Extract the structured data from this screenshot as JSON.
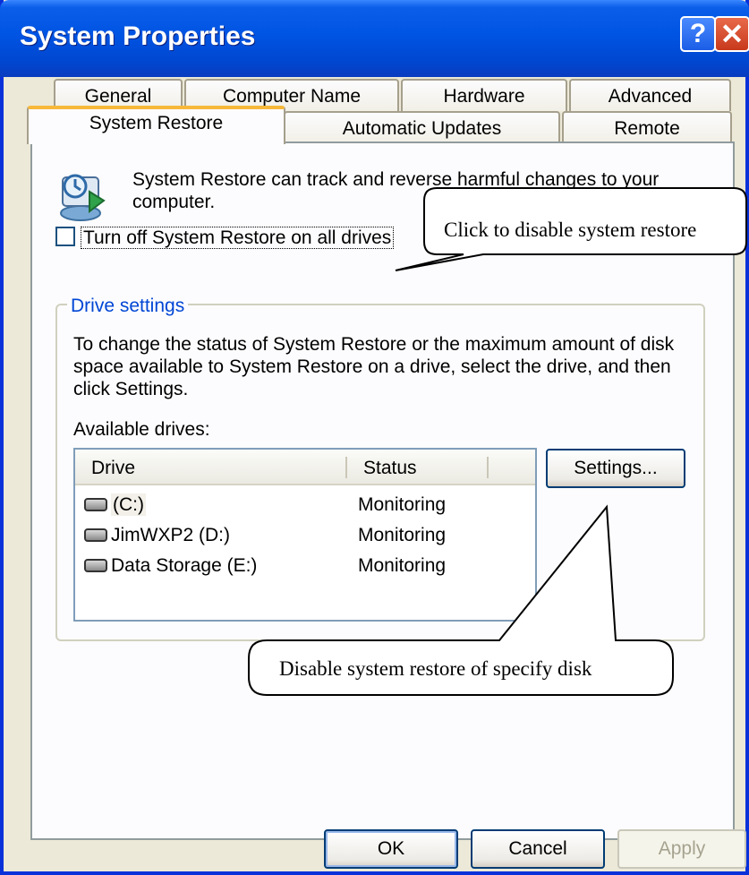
{
  "window": {
    "title": "System Properties",
    "help_glyph": "?",
    "close_glyph": "✕"
  },
  "tabs_row1": [
    "General",
    "Computer Name",
    "Hardware",
    "Advanced"
  ],
  "tabs_row2": [
    "System Restore",
    "Automatic Updates",
    "Remote"
  ],
  "active_tab": "System Restore",
  "intro_text": "System Restore can track and reverse harmful changes to your computer.",
  "checkbox": {
    "label": "Turn off System Restore on all drives",
    "checked": false
  },
  "drive_settings": {
    "group_label": "Drive settings",
    "description": "To change the status of System Restore or the maximum amount of disk space available to System Restore on a drive, select the drive, and then click Settings.",
    "available_label": "Available drives:",
    "columns": [
      "Drive",
      "Status"
    ],
    "drives": [
      {
        "name": "(C:)",
        "status": "Monitoring"
      },
      {
        "name": "JimWXP2 (D:)",
        "status": "Monitoring"
      },
      {
        "name": "Data Storage (E:)",
        "status": "Monitoring"
      }
    ],
    "settings_button": "Settings..."
  },
  "buttons": {
    "ok": "OK",
    "cancel": "Cancel",
    "apply": "Apply"
  },
  "callouts": {
    "top": "Click to disable system restore",
    "bottom": "Disable system restore of specify disk"
  },
  "colors": {
    "title_bar": "#0054e3",
    "dialog_bg": "#ece9d8",
    "active_tab_accent": "#f7b83a",
    "group_label": "#0046d5"
  },
  "icons": [
    "system-restore-icon",
    "help-icon",
    "close-icon",
    "drive-icon"
  ]
}
